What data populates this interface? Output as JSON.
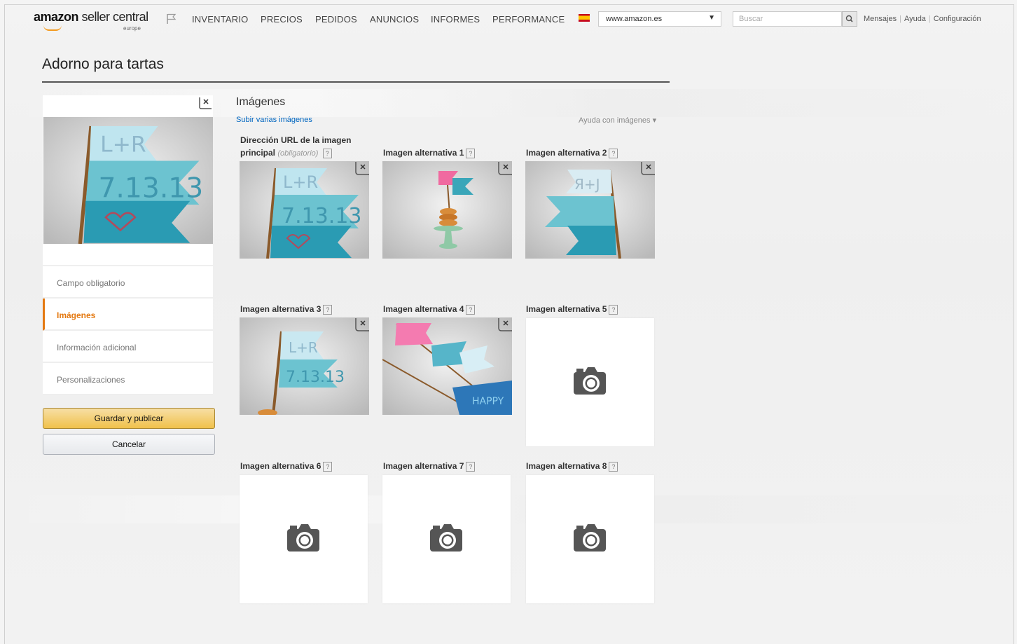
{
  "header": {
    "logo_brand": "amazon",
    "logo_rest": " seller central",
    "logo_region": "europe",
    "nav": [
      "INVENTARIO",
      "PRECIOS",
      "PEDIDOS",
      "ANUNCIOS",
      "INFORMES",
      "PERFORMANCE"
    ],
    "site_select": "www.amazon.es",
    "search_placeholder": "Buscar",
    "links": [
      "Mensajes",
      "Ayuda",
      "Configuración"
    ]
  },
  "page": {
    "title": "Adorno para tartas"
  },
  "sidebar": {
    "items": [
      {
        "label": "Campo obligatorio",
        "active": false
      },
      {
        "label": "Imágenes",
        "active": true
      },
      {
        "label": "Información adicional",
        "active": false
      },
      {
        "label": "Personalizaciones",
        "active": false
      }
    ],
    "save_label": "Guardar y publicar",
    "cancel_label": "Cancelar"
  },
  "images": {
    "title": "Imágenes",
    "upload_multiple": "Subir varias imágenes",
    "help": "Ayuda con imágenes",
    "main_label_1": "Dirección URL de la imagen",
    "main_label_2": "principal",
    "main_required": "(obligatorio)",
    "slots": [
      {
        "label": "Imagen alternativa 1"
      },
      {
        "label": "Imagen alternativa 2"
      },
      {
        "label": "Imagen alternativa 3"
      },
      {
        "label": "Imagen alternativa 4"
      },
      {
        "label": "Imagen alternativa 5"
      },
      {
        "label": "Imagen alternativa 6"
      },
      {
        "label": "Imagen alternativa 7"
      },
      {
        "label": "Imagen alternativa 8"
      }
    ]
  },
  "colors": {
    "accent": "#e47911",
    "link": "#0066c0",
    "save": "#f0c14b"
  }
}
